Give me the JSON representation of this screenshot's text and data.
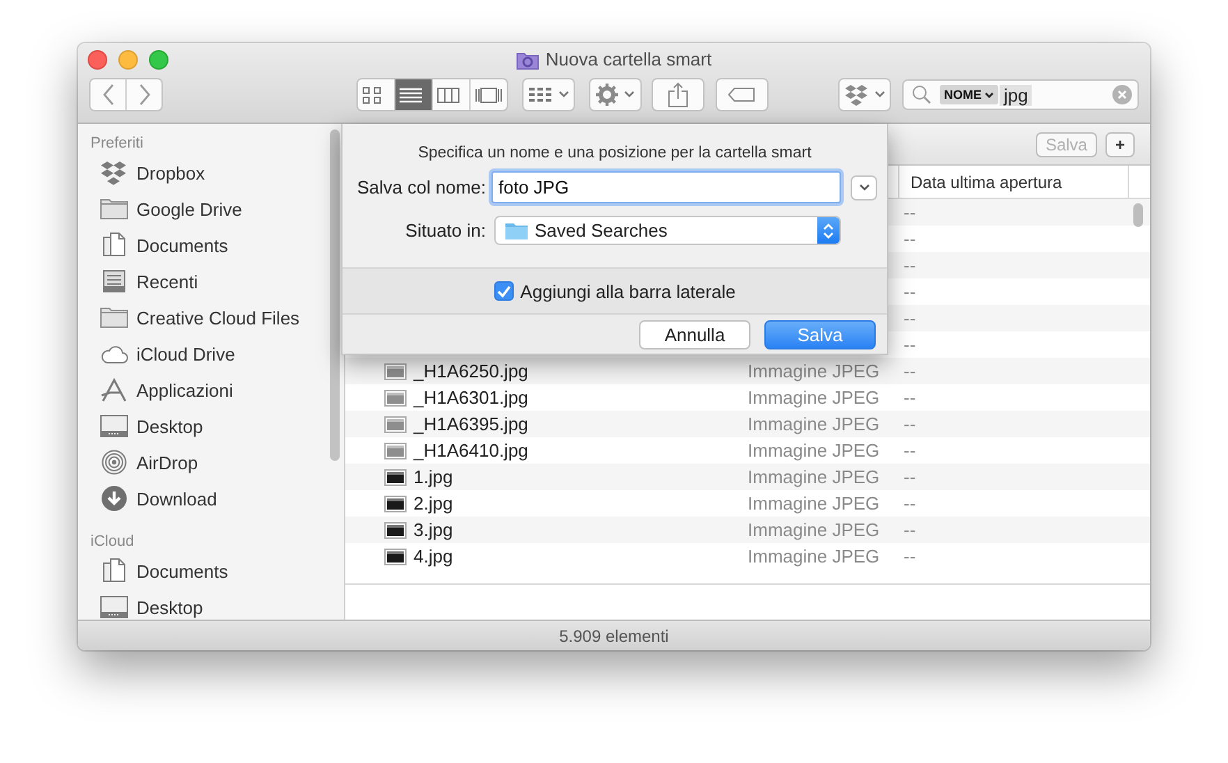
{
  "window": {
    "title": "Nuova cartella smart"
  },
  "toolbar": {
    "view_modes": [
      {
        "kind": "icons",
        "selected": false
      },
      {
        "kind": "list",
        "selected": true
      },
      {
        "kind": "columns",
        "selected": false
      },
      {
        "kind": "gallery",
        "selected": false
      }
    ],
    "search": {
      "token": "NOME",
      "value": "jpg"
    }
  },
  "sidebar": {
    "sections": [
      {
        "title": "Preferiti",
        "items": [
          {
            "label": "Dropbox",
            "kind": "dropbox"
          },
          {
            "label": "Google Drive",
            "kind": "folder"
          },
          {
            "label": "Documents",
            "kind": "documents"
          },
          {
            "label": "Recenti",
            "kind": "recents"
          },
          {
            "label": "Creative Cloud Files",
            "kind": "folder"
          },
          {
            "label": "iCloud Drive",
            "kind": "cloud"
          },
          {
            "label": "Applicazioni",
            "kind": "apps"
          },
          {
            "label": "Desktop",
            "kind": "desktop"
          },
          {
            "label": "AirDrop",
            "kind": "airdrop"
          },
          {
            "label": "Download",
            "kind": "download"
          }
        ]
      },
      {
        "title": "iCloud",
        "items": [
          {
            "label": "Documents",
            "kind": "documents"
          },
          {
            "label": "Desktop",
            "kind": "desktop"
          }
        ]
      }
    ]
  },
  "search_bar": {
    "buttons": [
      {
        "label": "Salva",
        "disabled": true
      },
      {
        "label": "+",
        "disabled": false
      }
    ]
  },
  "table": {
    "columns": [
      {
        "label": "Data ultima apertura"
      }
    ],
    "rows": [
      {
        "last_opened": "--"
      },
      {
        "last_opened": "--"
      },
      {
        "last_opened": "--"
      },
      {
        "last_opened": "--"
      },
      {
        "last_opened": "--"
      },
      {
        "last_opened": "--"
      },
      {
        "name": "_H1A6250.jpg",
        "type": "Immagine JPEG",
        "last_opened": "--",
        "kind": "plain"
      },
      {
        "name": "_H1A6301.jpg",
        "type": "Immagine JPEG",
        "last_opened": "--",
        "kind": "plain"
      },
      {
        "name": "_H1A6395.jpg",
        "type": "Immagine JPEG",
        "last_opened": "--",
        "kind": "plain"
      },
      {
        "name": "_H1A6410.jpg",
        "type": "Immagine JPEG",
        "last_opened": "--",
        "kind": "plain"
      },
      {
        "name": "1.jpg",
        "type": "Immagine JPEG",
        "last_opened": "--",
        "kind": "photo"
      },
      {
        "name": "2.jpg",
        "type": "Immagine JPEG",
        "last_opened": "--",
        "kind": "photo"
      },
      {
        "name": "3.jpg",
        "type": "Immagine JPEG",
        "last_opened": "--",
        "kind": "photo"
      },
      {
        "name": "4.jpg",
        "type": "Immagine JPEG",
        "last_opened": "--",
        "kind": "photo"
      }
    ]
  },
  "status_bar": "5.909 elementi",
  "sheet": {
    "message": "Specifica un nome e una posizione per la cartella smart",
    "name_label": "Salva col nome:",
    "name_value": "foto JPG",
    "location_label": "Situato in:",
    "location_value": "Saved Searches",
    "sidebar_checkbox": {
      "label": "Aggiungi alla barra laterale",
      "checked": true
    },
    "buttons": [
      {
        "label": "Annulla",
        "default": false
      },
      {
        "label": "Salva",
        "default": true
      }
    ]
  }
}
